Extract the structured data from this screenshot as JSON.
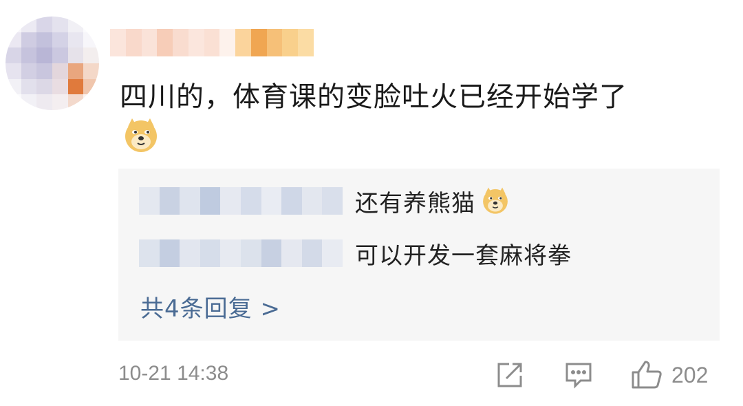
{
  "comment": {
    "text": "四川的，体育课的变脸吐火已经开始学了",
    "emoji": "doge-emoji"
  },
  "replies": [
    {
      "text": "还有养熊猫",
      "emoji": "doge-emoji"
    },
    {
      "text": "可以开发一套麻将拳"
    }
  ],
  "reply_count_label": "共4条回复 >",
  "footer": {
    "time": "10-21 14:38",
    "share_icon": "share-icon",
    "comment_icon": "comment-icon",
    "like_icon": "thumbs-up-icon",
    "like_count": "202"
  },
  "colors": {
    "link": "#4a6b94",
    "reply_bg": "#f6f6f6",
    "meta": "#8c8c8c"
  }
}
